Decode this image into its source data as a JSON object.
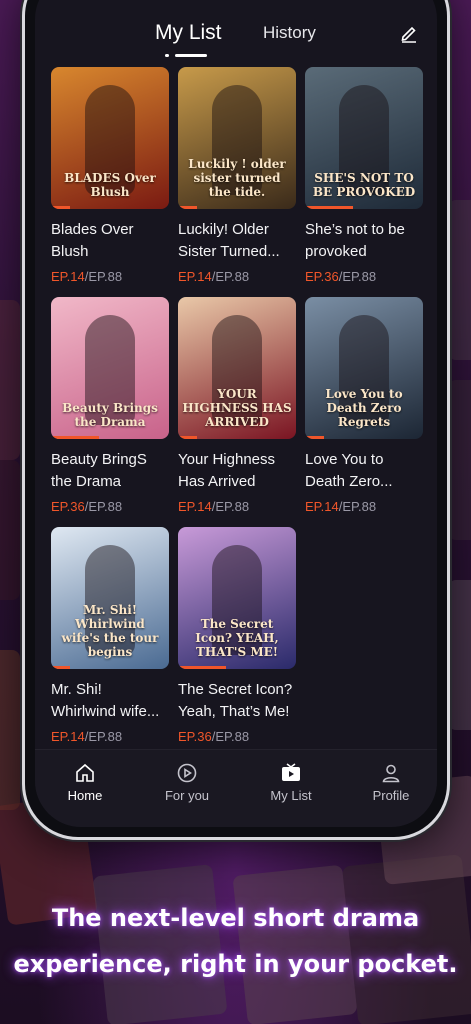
{
  "tabs": {
    "my_list": "My List",
    "history": "History"
  },
  "items": [
    {
      "title": "Blades Over Blush",
      "ep_current": "EP.14",
      "ep_total": "/EP.88",
      "poster_text": "BLADES Over Blush",
      "progress": 0.16,
      "colors": [
        "#7a1a12",
        "#d8872e"
      ]
    },
    {
      "title": "Luckily! Older Sister Turned...",
      "ep_current": "EP.14",
      "ep_total": "/EP.88",
      "poster_text": "Luckily ! older sister turned the tide.",
      "progress": 0.16,
      "colors": [
        "#3a2a1a",
        "#c79a4a"
      ]
    },
    {
      "title": "She’s not to be provoked",
      "ep_current": "EP.36",
      "ep_total": "/EP.88",
      "poster_text": "SHE'S NOT TO BE PROVOKED",
      "progress": 0.41,
      "colors": [
        "#1e2a38",
        "#5a6b78"
      ]
    },
    {
      "title": "Beauty BringS the Drama",
      "ep_current": "EP.36",
      "ep_total": "/EP.88",
      "poster_text": "Beauty Brings the Drama",
      "progress": 0.41,
      "colors": [
        "#c8628a",
        "#f1b8c8"
      ]
    },
    {
      "title": "Your Highness Has Arrived",
      "ep_current": "EP.14",
      "ep_total": "/EP.88",
      "poster_text": "YOUR HIGHNESS HAS ARRIVED",
      "progress": 0.16,
      "colors": [
        "#7a1422",
        "#e9c8a8"
      ]
    },
    {
      "title": "Love You to Death Zero...",
      "ep_current": "EP.14",
      "ep_total": "/EP.88",
      "poster_text": "Love You to Death Zero Regrets",
      "progress": 0.16,
      "colors": [
        "#1c2634",
        "#7a8ea4"
      ]
    },
    {
      "title": "Mr. Shi! Whirlwind wife...",
      "ep_current": "EP.14",
      "ep_total": "/EP.88",
      "poster_text": "Mr. Shi! Whirlwind wife's the tour begins",
      "progress": 0.16,
      "colors": [
        "#4a6a92",
        "#dfe8f2"
      ]
    },
    {
      "title": "The Secret Icon? Yeah, That’s Me!",
      "ep_current": "EP.36",
      "ep_total": "/EP.88",
      "poster_text": "The Secret Icon? YEAH, THAT'S ME!",
      "progress": 0.41,
      "colors": [
        "#2a2a6a",
        "#c89ad8"
      ]
    }
  ],
  "nav": [
    {
      "label": "Home",
      "icon": "home-icon"
    },
    {
      "label": "For you",
      "icon": "play-circle-icon"
    },
    {
      "label": "My List",
      "icon": "tv-play-icon"
    },
    {
      "label": "Profile",
      "icon": "person-icon"
    }
  ],
  "tagline": [
    "The next-level short drama",
    "experience, right in your pocket."
  ],
  "accent_color": "#f0562a"
}
